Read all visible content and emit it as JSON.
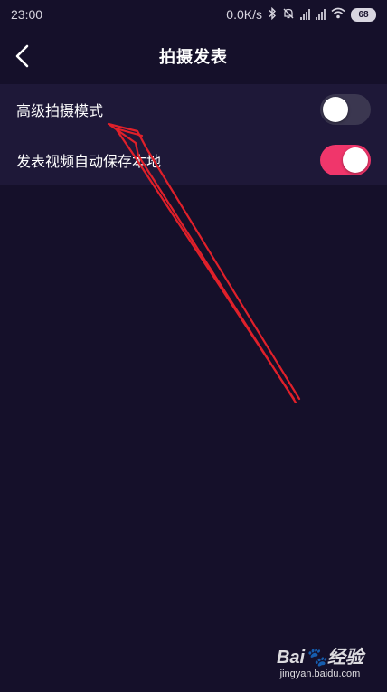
{
  "status_bar": {
    "time": "23:00",
    "net_speed": "0.0K/s",
    "battery": "68"
  },
  "header": {
    "title": "拍摄发表"
  },
  "settings": [
    {
      "label": "高级拍摄模式",
      "enabled": false
    },
    {
      "label": "发表视频自动保存本地",
      "enabled": true
    }
  ],
  "colors": {
    "background": "#15102a",
    "panel": "#1e1838",
    "toggle_on": "#f0366b",
    "toggle_off": "#3b3750",
    "annotation_arrow": "#e0202a"
  },
  "watermark": {
    "logo": "Bai🐾经验",
    "url": "jingyan.baidu.com"
  }
}
